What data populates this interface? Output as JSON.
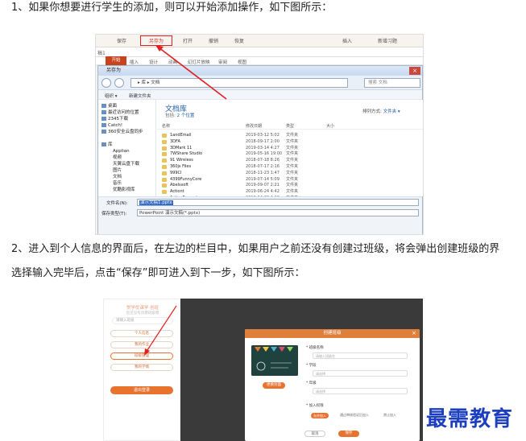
{
  "step1": "1、如果你想要进行学生的添加，则可以开始添加操作，如下图所示：",
  "step2_line1": "2、进入到个人信息的界面后，在左边的栏目中，如果用户之前还没有创建过班级，将会弹出创建班级的界",
  "step2_line2": "选择输入完毕后，点击“保存”即可进入到下一步，如下图所示：",
  "watermark": "最需教育",
  "screenshot1": {
    "toolbar": {
      "save": "保存",
      "save_as": "另存为",
      "open": "打开",
      "undo": "撤销",
      "redo": "恢复",
      "insert": "插入",
      "new_lesson": "新增习题"
    },
    "doc_tab": "稿1",
    "ribbon_tabs": [
      "开始",
      "插入",
      "设计",
      "动画",
      "幻灯片放映",
      "审阅",
      "视图"
    ],
    "dialog_title": "另存为",
    "dialog_close": "×",
    "address": [
      "库",
      "文档"
    ],
    "search_placeholder": "搜索 文档",
    "organize": "组织 ▾",
    "new_folder": "新建文件夹",
    "nav_items": [
      "桌面",
      "最近访问的位置",
      "2345下载",
      "Catch!",
      "360安全云盘同步",
      "库",
      "Applian",
      "视频",
      "天翼云盘下载",
      "图片",
      "文档",
      "音乐",
      "优酷影视库"
    ],
    "library_title": "文档库",
    "library_sub_prefix": "包括:",
    "library_sub_link": "2 个位置",
    "arrange_label": "排列方式:",
    "arrange_value": "文件夹 ▾",
    "columns": [
      "名称",
      "修改日期",
      "类型",
      "大小"
    ],
    "files": [
      {
        "name": "1andEmail",
        "date": "2019-03-12 5:02",
        "type": "文件夹"
      },
      {
        "name": "3DFA",
        "date": "2018-09-17 2:00",
        "type": "文件夹"
      },
      {
        "name": "3DMark 11",
        "date": "2019-03-14 4:27",
        "type": "文件夹"
      },
      {
        "name": "7WShare Studio",
        "date": "2019-05-16 19:00",
        "type": "文件夹"
      },
      {
        "name": "91 Wireless",
        "date": "2018-07-18 8:26",
        "type": "文件夹"
      },
      {
        "name": "360js Files",
        "date": "2018-07-17 2:16",
        "type": "文件夹"
      },
      {
        "name": "999CI",
        "date": "2018-11-23 1:47",
        "type": "文件夹"
      },
      {
        "name": "4399FunnyCore",
        "date": "2019-07-14 5:09",
        "type": "文件夹"
      },
      {
        "name": "Abelssoft",
        "date": "2019-09-07 2:21",
        "type": "文件夹"
      },
      {
        "name": "Actiont",
        "date": "2019-06-24 4:42",
        "type": "文件夹"
      },
      {
        "name": "ActivePresenter",
        "date": "2019-04-20 4:23",
        "type": "文件夹"
      }
    ],
    "filename_label": "文件名(N):",
    "filename_value": "演示文稿1.pptx",
    "filetype_label": "保存类型(T):",
    "filetype_value": "PowerPoint 演示文稿(*.pptx)"
  },
  "screenshot2": {
    "brand": "悦学优课学·创班",
    "sub": "您还没有创建班级哦",
    "input_placeholder": "请输入班级",
    "buttons": [
      "个人信息",
      "我的作业",
      "班级管理",
      "我的学情"
    ],
    "primary": "退出登录",
    "modal_title": "创建班级",
    "modal_close": "×",
    "upload_btn": "更换封面",
    "labels": [
      "* 班级名称",
      "* 学段",
      "* 年级",
      "* 加入权限"
    ],
    "inputs": [
      "请输入班级名",
      "请选择",
      "请选择"
    ],
    "radios": [
      "允许加入",
      "通过审核验证后加入",
      "禁止加入"
    ],
    "cancel": "取消",
    "save": "保存"
  },
  "colors": {
    "accent_orange": "#e8732f",
    "highlight_red": "#e02020",
    "watermark": "#1d3fbf"
  }
}
